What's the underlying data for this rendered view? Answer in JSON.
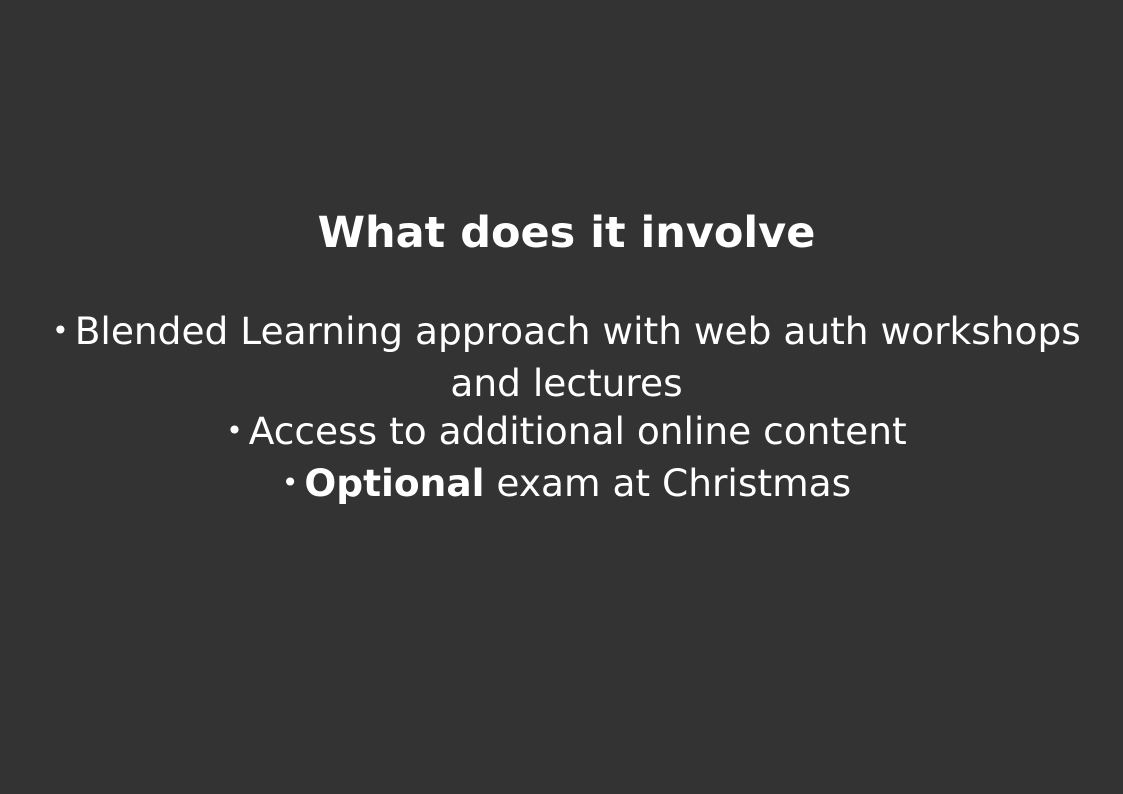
{
  "slide": {
    "background": "#333333",
    "text_color": "#ffffff",
    "title": "What does it involve",
    "bullet_glyph": "•",
    "bullets": [
      {
        "text": "Blended Learning approach with web auth workshops and lectures"
      },
      {
        "text": "Access to additional online content"
      },
      {
        "bold": "Optional",
        "text": " exam at Christmas"
      }
    ]
  }
}
